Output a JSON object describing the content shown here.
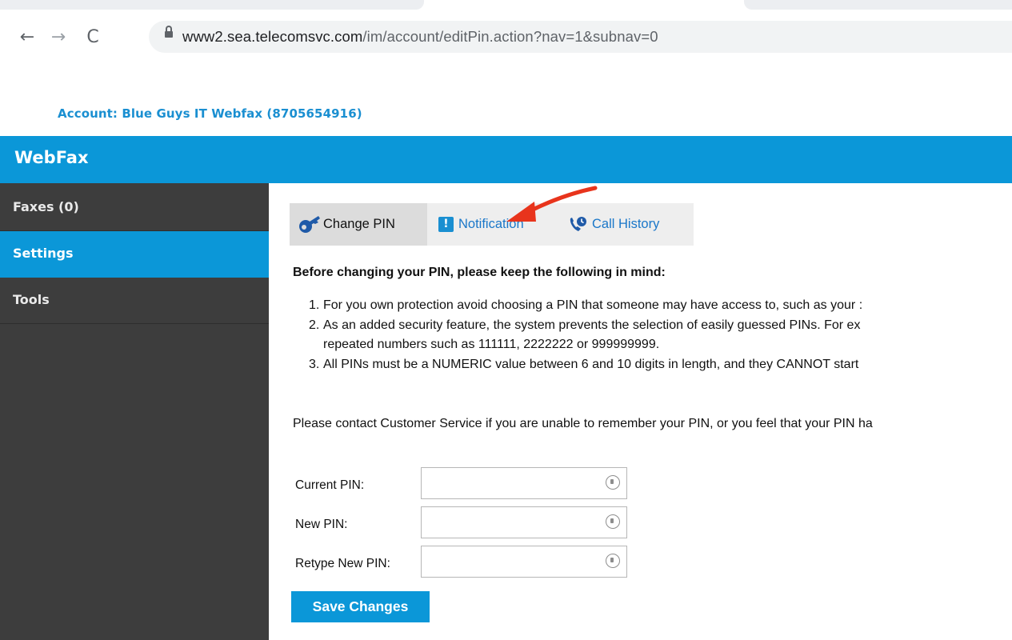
{
  "browser": {
    "url_host": "www2.sea.telecomsvc.com",
    "url_path": "/im/account/editPin.action?nav=1&subnav=0",
    "back_icon": "←",
    "forward_icon": "→",
    "reload_icon": "C"
  },
  "account_label": "Account: Blue Guys IT Webfax (8705654916)",
  "app_title": "WebFax",
  "sidebar": {
    "items": [
      {
        "label": "Faxes (0)"
      },
      {
        "label": "Settings",
        "active": true
      },
      {
        "label": "Tools"
      }
    ]
  },
  "tabs": [
    {
      "label": "Change PIN",
      "icon": "key-icon",
      "active": true
    },
    {
      "label": "Notification",
      "icon": "notification-icon"
    },
    {
      "label": "Call History",
      "icon": "call-history-icon"
    }
  ],
  "heading": "Before changing your PIN, please keep the following in mind:",
  "rules": [
    {
      "num": "1.",
      "text": "For you own protection avoid choosing a PIN that someone may have access to, such as your :"
    },
    {
      "num": "2.",
      "text": "As an added security feature, the system prevents the selection of easily guessed PINs. For ex"
    },
    {
      "num": "",
      "text": "repeated numbers such as 111111, 2222222 or 999999999."
    },
    {
      "num": "3.",
      "text": "All PINs must be a NUMERIC value between 6 and 10 digits in length, and they CANNOT start"
    }
  ],
  "contact_text": "Please contact Customer Service if you are unable to remember your PIN, or you feel that your PIN ha",
  "form": {
    "current_pin_label": "Current PIN:",
    "current_pin_value": "",
    "new_pin_label": "New PIN:",
    "new_pin_value": "",
    "retype_pin_label": "Retype New PIN:",
    "retype_pin_value": ""
  },
  "save_label": "Save Changes",
  "colors": {
    "brand_blue": "#0b97d8",
    "sidebar_bg": "#3d3d3d",
    "annotation_arrow": "#e8341c"
  }
}
